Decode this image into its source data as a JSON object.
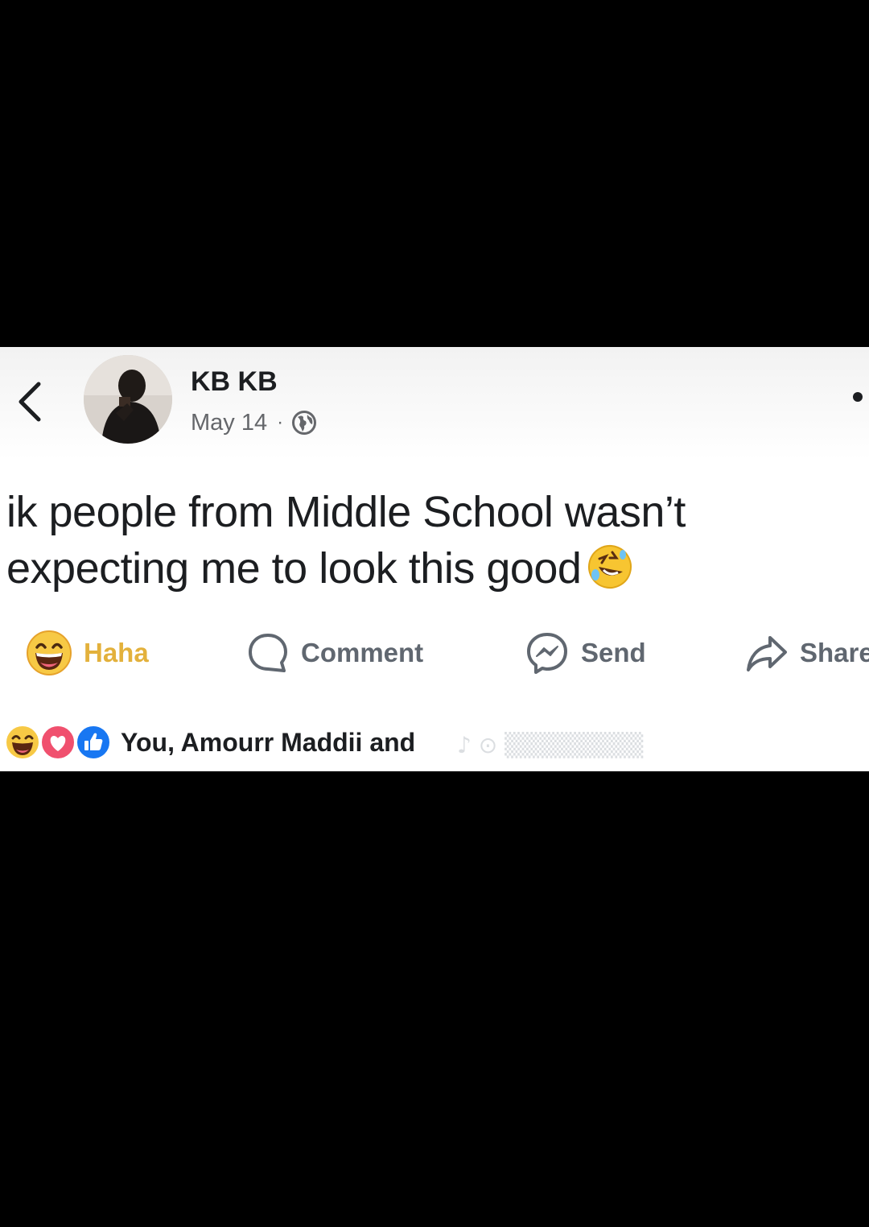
{
  "post": {
    "author": "KB KB",
    "date": "May 14",
    "separator": "·",
    "privacy_icon": "globe-icon",
    "text": "ik people from Middle School wasn’t expecting me to look this good",
    "text_emoji": "rolling-on-floor-laughing-emoji"
  },
  "actions": {
    "haha_label": "Haha",
    "comment_label": "Comment",
    "send_label": "Send",
    "share_label": "Share"
  },
  "reactions": {
    "icons": [
      "haha-reaction-icon",
      "love-reaction-icon",
      "like-reaction-icon"
    ],
    "summary": "You, Amourr Maddii and"
  },
  "colors": {
    "haha": "#e3b13c",
    "like": "#1877f2",
    "love": "#f0506e",
    "text": "#1c1e21",
    "muted": "#65676b",
    "background": "#000000"
  }
}
